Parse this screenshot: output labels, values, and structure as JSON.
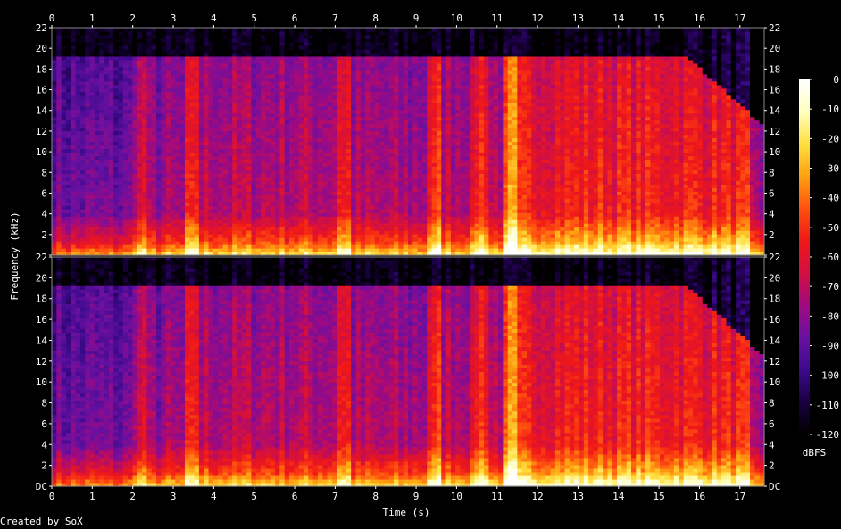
{
  "chart_data": {
    "type": "heatmap",
    "title": "",
    "xlabel": "Time (s)",
    "ylabel": "Frequency (kHz)",
    "xlim": [
      0,
      17.6
    ],
    "ylim": [
      0,
      22
    ],
    "x_ticks": [
      "0",
      "1",
      "2",
      "3",
      "4",
      "5",
      "6",
      "7",
      "8",
      "9",
      "10",
      "11",
      "12",
      "13",
      "14",
      "15",
      "16",
      "17"
    ],
    "y_ticks": [
      "DC",
      "2",
      "4",
      "6",
      "8",
      "10",
      "12",
      "14",
      "16",
      "18",
      "20",
      "22"
    ],
    "y_tick_values": [
      0,
      2,
      4,
      6,
      8,
      10,
      12,
      14,
      16,
      18,
      20,
      22
    ],
    "channels": [
      "top",
      "bottom"
    ],
    "colorbar": {
      "label": "dBFS",
      "ticks": [
        "0",
        "-10",
        "-20",
        "-30",
        "-40",
        "-50",
        "-60",
        "-70",
        "-80",
        "-90",
        "-100",
        "-110",
        "-120"
      ],
      "tick_values": [
        0,
        -10,
        -20,
        -30,
        -40,
        -50,
        -60,
        -70,
        -80,
        -90,
        -100,
        -110,
        -120
      ],
      "range": [
        -120,
        0
      ],
      "colors": [
        "#000000",
        "#1a0040",
        "#3c0a8c",
        "#6a10a0",
        "#a00a80",
        "#d21040",
        "#f01818",
        "#ff5010",
        "#ffa010",
        "#ffe040",
        "#ffffc0",
        "#ffffff"
      ]
    },
    "bandwidth_cutoff_khz": 19.2,
    "segment_boundaries_s": [
      2.2,
      3.5,
      7.2,
      9.5,
      10.6,
      11.3
    ]
  },
  "credit": "Created by SoX"
}
